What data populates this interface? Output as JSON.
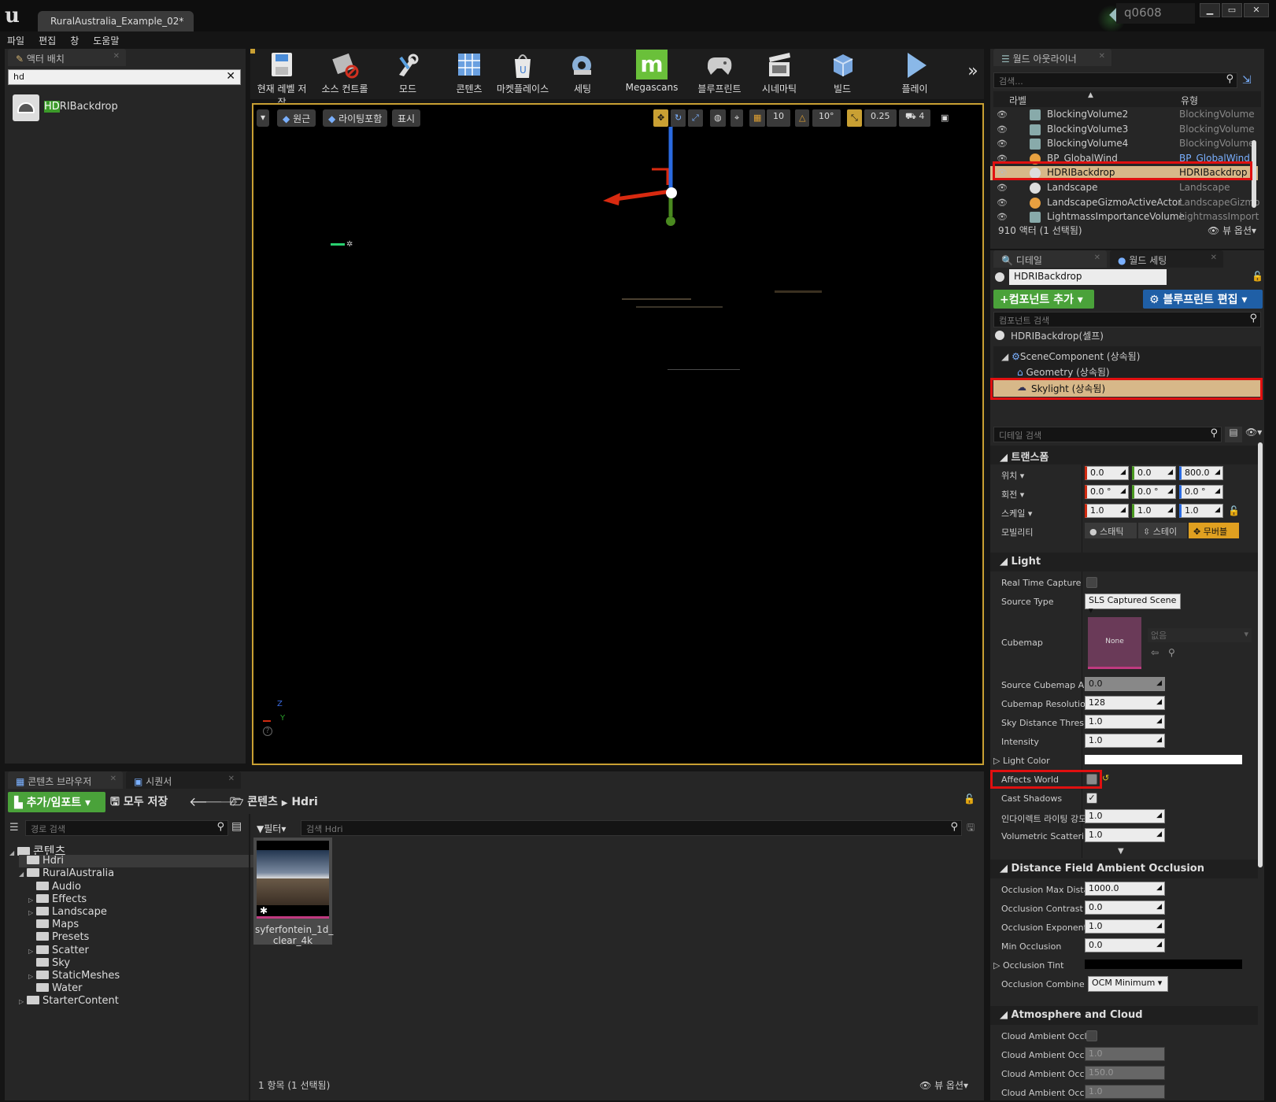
{
  "window": {
    "tab_title": "RuralAustralia_Example_02*",
    "user": "q0608",
    "controls": [
      "▁",
      "▭",
      "✕"
    ]
  },
  "menu": [
    "파일",
    "편집",
    "창",
    "도움말"
  ],
  "place_actors": {
    "tab": "액터 배치",
    "search_value": "hd",
    "result_highlight": "HD",
    "result_rest": "RIBackdrop"
  },
  "toolbar": {
    "buttons": [
      "현재 레벨 저장",
      "소스 컨트롤",
      "모드",
      "콘텐츠",
      "마켓플레이스",
      "세팅",
      "Megascans",
      "블루프린트",
      "시네마틱",
      "빌드",
      "플레이"
    ],
    "overflow": "»"
  },
  "viewport": {
    "perspective": "원근",
    "lit": "라이팅포함",
    "show": "표시",
    "grid_snap": "10",
    "rot_snap": "10°",
    "scale_snap": "0.25",
    "camera_speed": "4",
    "axis_z": "Z",
    "axis_y": "Y"
  },
  "outliner": {
    "tab": "월드 아웃라이너",
    "search_placeholder": "검색...",
    "col_label": "라벨",
    "col_type": "유형",
    "rows": [
      {
        "label": "BlockingVolume2",
        "type": "BlockingVolume"
      },
      {
        "label": "BlockingVolume3",
        "type": "BlockingVolume"
      },
      {
        "label": "BlockingVolume4",
        "type": "BlockingVolume"
      },
      {
        "label": "BP_GlobalWind",
        "type": "BP_GlobalWind"
      },
      {
        "label": "HDRIBackdrop",
        "type": "HDRIBackdrop"
      },
      {
        "label": "Landscape",
        "type": "Landscape"
      },
      {
        "label": "LandscapeGizmoActiveActor",
        "type": "LandscapeGizmo"
      },
      {
        "label": "LightmassImportanceVolume",
        "type": "LightmassImport"
      }
    ],
    "status": "910 액터 (1 선택됨)",
    "view_options": "뷰 옵션"
  },
  "details": {
    "tab": "디테일",
    "tab2": "월드 세팅",
    "actor_name": "HDRIBackdrop",
    "add_component": "+컴포넌트 추가",
    "edit_blueprint": "블루프린트 편집",
    "component_search": "컴포넌트 검색",
    "self": "HDRIBackdrop(셀프)",
    "components": [
      "SceneComponent (상속됨)",
      "Geometry (상속됨)",
      "Skylight (상속됨)"
    ],
    "detail_search": "디테일 검색",
    "transform": {
      "header": "트랜스폼",
      "location_label": "위치",
      "rotation_label": "회전",
      "scale_label": "스케일",
      "mobility_label": "모빌리티",
      "location": [
        "0.0",
        "0.0",
        "800.0"
      ],
      "rotation": [
        "0.0 °",
        "0.0 °",
        "0.0 °"
      ],
      "scale": [
        "1.0",
        "1.0",
        "1.0"
      ],
      "mobility": [
        "스태틱",
        "스테이",
        "무버블"
      ]
    },
    "light": {
      "header": "Light",
      "real_time_capture": "Real Time Capture",
      "source_type": "Source Type",
      "source_type_value": "SLS Captured Scene",
      "cubemap": "Cubemap",
      "cubemap_none": "None",
      "cubemap_asset": "없음",
      "source_cubemap_angle": "Source Cubemap Ang",
      "source_cubemap_angle_value": "0.0",
      "cubemap_resolution": "Cubemap Resolution",
      "cubemap_resolution_value": "128",
      "sky_distance": "Sky Distance Thresh",
      "sky_distance_value": "1.0",
      "intensity": "Intensity",
      "intensity_value": "1.0",
      "light_color": "Light Color",
      "affects_world": "Affects World",
      "cast_shadows": "Cast Shadows",
      "indirect": "인다이렉트 라이팅 강도",
      "indirect_value": "1.0",
      "volumetric": "Volumetric Scattering",
      "volumetric_value": "1.0"
    },
    "dfao": {
      "header": "Distance Field Ambient Occlusion",
      "max_dist": "Occlusion Max Distance",
      "max_dist_value": "1000.0",
      "contrast": "Occlusion Contrast",
      "contrast_value": "0.0",
      "exponent": "Occlusion Exponent",
      "exponent_value": "1.0",
      "min": "Min Occlusion",
      "min_value": "0.0",
      "tint": "Occlusion Tint",
      "combine": "Occlusion Combine Mode",
      "combine_value": "OCM Minimum"
    },
    "atmosphere": {
      "header": "Atmosphere and Cloud",
      "rows": [
        {
          "label": "Cloud Ambient Occlusion",
          "value": ""
        },
        {
          "label": "Cloud Ambient Occlusion Extinction",
          "value": "1.0"
        },
        {
          "label": "Cloud Ambient Occlusion Extent",
          "value": "150.0"
        },
        {
          "label": "Cloud Ambient Occlusion Map",
          "value": "1.0"
        }
      ]
    }
  },
  "content_browser": {
    "tab": "콘텐츠 브라우저",
    "tab2": "시퀀서",
    "add_import": "추가/임포트",
    "save_all": "모두 저장",
    "path_root": "콘텐츠",
    "path_leaf": "Hdri",
    "path_search": "경로 검색",
    "filter": "필터",
    "asset_search": "검색 Hdri",
    "tree": [
      {
        "name": "콘텐츠",
        "depth": 0,
        "arrow": "◢"
      },
      {
        "name": "Hdri",
        "depth": 1,
        "arrow": ""
      },
      {
        "name": "RuralAustralia",
        "depth": 1,
        "arrow": "◢"
      },
      {
        "name": "Audio",
        "depth": 2,
        "arrow": ""
      },
      {
        "name": "Effects",
        "depth": 2,
        "arrow": "▷"
      },
      {
        "name": "Landscape",
        "depth": 2,
        "arrow": "▷"
      },
      {
        "name": "Maps",
        "depth": 2,
        "arrow": ""
      },
      {
        "name": "Presets",
        "depth": 2,
        "arrow": ""
      },
      {
        "name": "Scatter",
        "depth": 2,
        "arrow": "▷"
      },
      {
        "name": "Sky",
        "depth": 2,
        "arrow": ""
      },
      {
        "name": "StaticMeshes",
        "depth": 2,
        "arrow": "▷"
      },
      {
        "name": "Water",
        "depth": 2,
        "arrow": ""
      },
      {
        "name": "StarterContent",
        "depth": 1,
        "arrow": "▷"
      }
    ],
    "asset_name_1": "syferfontein_1d_",
    "asset_name_2": "clear_4k",
    "status": "1 항목 (1 선택됨)",
    "view_options": "뷰 옵션"
  },
  "colors": {
    "accent_orange": "#c9a033",
    "selection_red": "#e01010",
    "green_button": "#4aa23a",
    "blue_button": "#1f5fa6"
  }
}
